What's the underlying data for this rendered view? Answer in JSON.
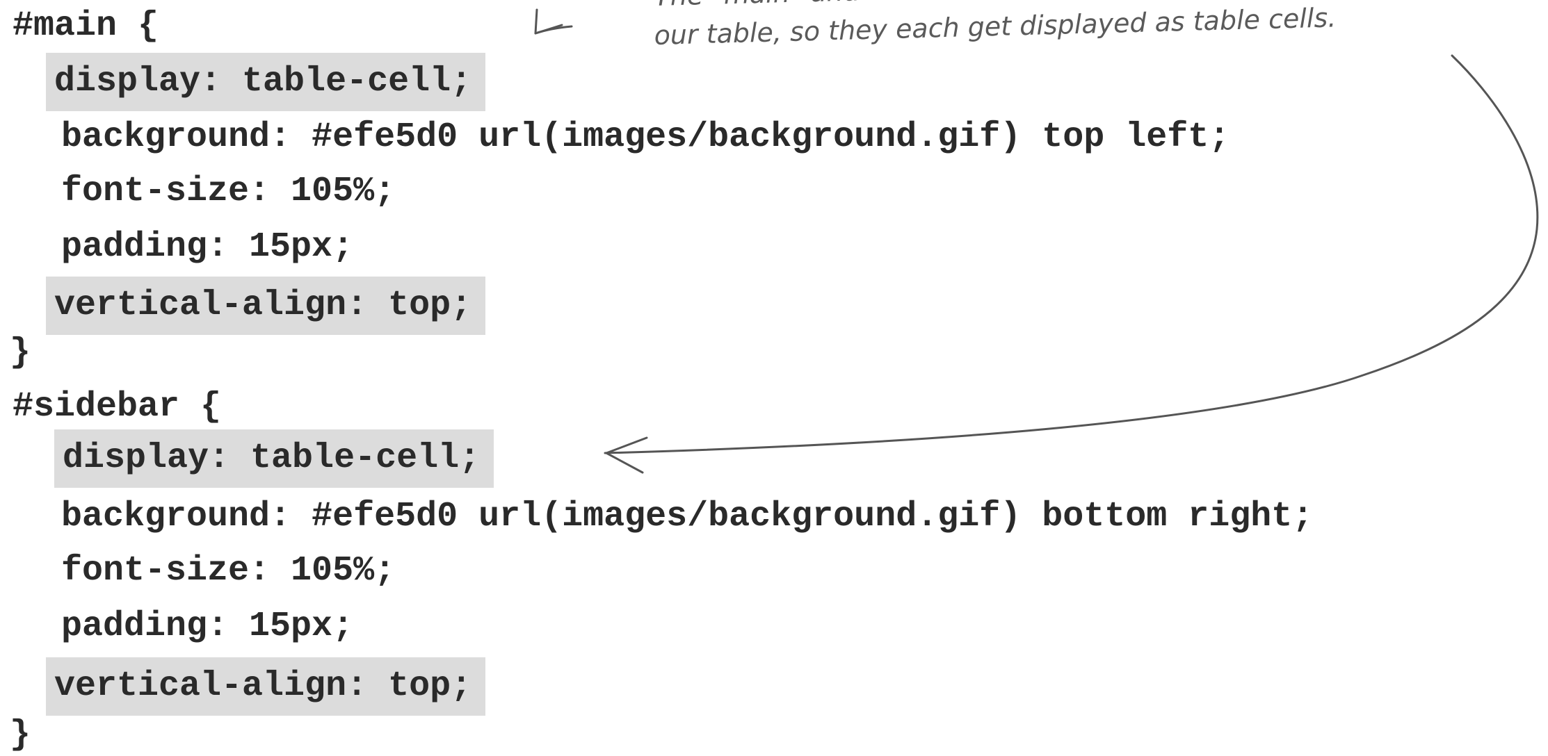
{
  "code": {
    "main_selector": "#main {",
    "main_display": "display: table-cell;",
    "main_background": "background: #efe5d0 url(images/background.gif) top left;",
    "main_font_size": "font-size: 105%;",
    "main_padding": "padding: 15px;",
    "main_vertical_align": "vertical-align: top;",
    "main_close": "}",
    "sidebar_selector": "#sidebar {",
    "sidebar_display": "display: table-cell;",
    "sidebar_background": "background: #efe5d0 url(images/background.gif) bottom right;",
    "sidebar_font_size": "font-size: 105%;",
    "sidebar_padding": "padding: 15px;",
    "sidebar_vertical_align": "vertical-align: top;",
    "sidebar_close": "}"
  },
  "annotation": {
    "line1": "The \"main\" and \"sidebar\" <divs> are the cells in",
    "line2": "our table, so they each get displayed as table cells."
  },
  "colors": {
    "highlight": "#dcdcdc",
    "code_text": "#2a2a2a",
    "annotation_text": "#5a5a5a",
    "arrow": "#555555"
  }
}
